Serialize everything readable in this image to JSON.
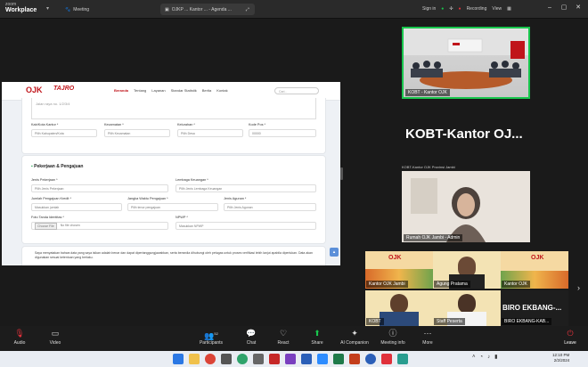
{
  "app": {
    "brand_line1": "zoom",
    "brand_line2": "Workplace"
  },
  "titlebar": {
    "tab1": "Meeting",
    "tab2": "OJKP ... Kantor ... - Agenda ...",
    "sign_in": "Sign in",
    "recording": "Recording",
    "view": "View"
  },
  "website": {
    "logo": "OJK",
    "logo_tag": "TAJRO",
    "nav": [
      "Beranda",
      "Tentang",
      "Layanan",
      "Standar Statistik",
      "Berita",
      "Kontak"
    ],
    "search_placeholder": "Cari...",
    "textarea_value": "Jalan raya no. 1/2/3/4",
    "row1": [
      {
        "label": "Kab/Kota Kantor *",
        "value": "Pilih Kabupaten/Kota"
      },
      {
        "label": "Kecamatan *",
        "value": "Pilih Kecamatan"
      },
      {
        "label": "Kelurahan *",
        "value": "Pilih Desa"
      },
      {
        "label": "Kode Pos *",
        "value": "00000"
      }
    ],
    "section_title": "Pekerjaan & Pengajuan",
    "row2": [
      {
        "label": "Jenis Pekerjaan *",
        "value": "Pilih Jenis Pekerjaan"
      },
      {
        "label": "Lembaga Keuangan *",
        "value": "Pilih Jenis Lembaga Keuangan"
      }
    ],
    "row3": [
      {
        "label": "Jumlah Pengajuan Kredit *",
        "value": "Masukkan jumlah"
      },
      {
        "label": "Jangka Waktu Pengajuan *",
        "value": "Pilih tenor pengajuan"
      },
      {
        "label": "Jenis Agunan *",
        "value": "Pilih Jenis Agunan"
      }
    ],
    "row4": [
      {
        "label": "Foto Tanda Identitas *",
        "choose": "Choose File",
        "file": "No file chosen"
      },
      {
        "label": "NPWP *",
        "value": "Masukkan NPWP"
      }
    ],
    "consent_text": "Saya menyatakan bahwa data yang saya isikan adalah benar dan dapat dipertanggungjawabkan, serta bersedia dihubungi oleh petugas untuk proses verifikasi lebih lanjut apabila diperlukan. Data akan digunakan sesuai ketentuan yang berlaku."
  },
  "videos": {
    "tile1_name": "KOBT - Kantor OJK",
    "big_name": "KOBT-Kantor  OJ...",
    "tile3_header": "KOBT-Kantor OJK Provinsi Jambi",
    "tile3_name": "Rumah OJK Jambi - Admin",
    "tile4_names": [
      "Kantor OJK Jambi",
      "Agung Pratama",
      "Kantor OJK"
    ],
    "tile5_names": [
      "KOBT",
      "Staff Peserta"
    ],
    "biro": "BIRO  EKBANG-...",
    "biro_sub": "BIRO EKBANG-KAB..."
  },
  "toolbar": [
    {
      "icon": "mic-icon",
      "label": "Audio"
    },
    {
      "icon": "video-icon",
      "label": "Video"
    },
    {
      "icon": "participants-icon",
      "label": "Participants",
      "count": "52"
    },
    {
      "icon": "chat-icon",
      "label": "Chat"
    },
    {
      "icon": "react-icon",
      "label": "React"
    },
    {
      "icon": "share-icon",
      "label": "Share"
    },
    {
      "icon": "ai-companion-icon",
      "label": "AI Companion"
    },
    {
      "icon": "info-icon",
      "label": "Meeting info"
    },
    {
      "icon": "more-icon",
      "label": "More"
    },
    {
      "icon": "leave-icon",
      "label": "Leave"
    }
  ],
  "taskbar": {
    "time": "12:10 PM",
    "date": "2/2/2024"
  },
  "colors": {
    "share_accent": "#18c64d",
    "leave": "#e0313b",
    "brand_red": "#c0151b"
  }
}
